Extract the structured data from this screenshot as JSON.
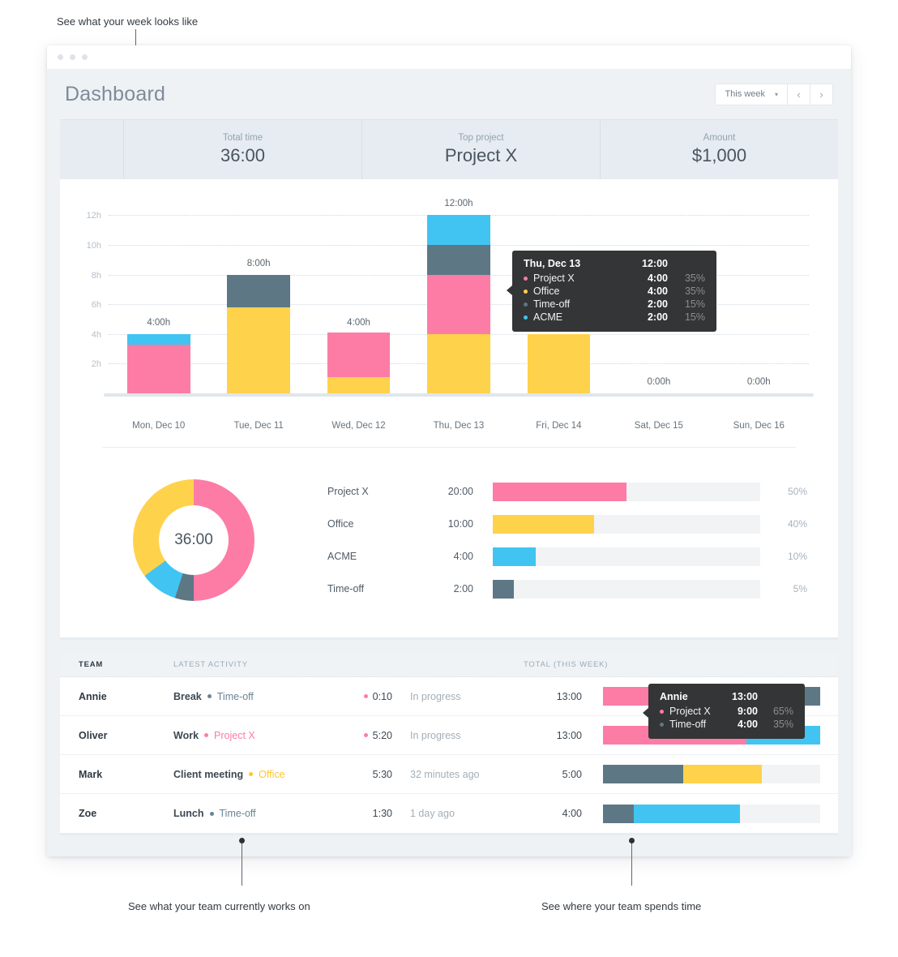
{
  "colors": {
    "project_x": "#fd7ca6",
    "office": "#ffd24c",
    "acme": "#41c4f2",
    "time_off": "#5d7785",
    "track": "#f1f3f4",
    "tooltip_bg": "#333536"
  },
  "annotations": {
    "top": "See what your week looks like",
    "bottom_left": "See what your team currently works on",
    "bottom_right": "See where your team spends time"
  },
  "header": {
    "title": "Dashboard",
    "range_selector": "This week",
    "prev_label": "‹",
    "next_label": "›",
    "caret": "▾"
  },
  "kpis": [
    {
      "label": "Total time",
      "value": "36:00"
    },
    {
      "label": "Top project",
      "value": "Project X"
    },
    {
      "label": "Amount",
      "value": "$1,000"
    }
  ],
  "chart_data": {
    "type": "bar",
    "title": "",
    "xlabel": "",
    "ylabel": "",
    "ylim": [
      0,
      13
    ],
    "grid": true,
    "yticks": [
      "2h",
      "4h",
      "6h",
      "8h",
      "10h",
      "12h"
    ],
    "ytick_values": [
      2,
      4,
      6,
      8,
      10,
      12
    ],
    "categories": [
      "Mon, Dec 10",
      "Tue, Dec 11",
      "Wed, Dec 12",
      "Thu, Dec 13",
      "Fri, Dec 14",
      "Sat, Dec 15",
      "Sun, Dec 16"
    ],
    "totals_label": [
      "4:00h",
      "8:00h",
      "4:00h",
      "12:00h",
      "",
      "0:00h",
      "0:00h"
    ],
    "totals": [
      4,
      8,
      4,
      12,
      4,
      0,
      0
    ],
    "series": [
      {
        "name": "Project X",
        "color": "#fd7ca6",
        "values": [
          3.3,
          0,
          3.0,
          4,
          0,
          0,
          0
        ]
      },
      {
        "name": "Office",
        "color": "#ffd24c",
        "values": [
          0,
          5.8,
          1.1,
          4,
          4,
          0,
          0
        ]
      },
      {
        "name": "Time-off",
        "color": "#5d7785",
        "values": [
          0,
          2.2,
          0,
          2,
          0,
          0,
          0
        ]
      },
      {
        "name": "ACME",
        "color": "#41c4f2",
        "values": [
          0.7,
          0,
          0,
          2,
          0,
          0,
          0
        ]
      }
    ],
    "legend_position": "none"
  },
  "bar_tooltip": {
    "title": "Thu, Dec 13",
    "total": "12:00",
    "rows": [
      {
        "name": "Project X",
        "value": "4:00",
        "pct": "35%",
        "color": "#fd7ca6"
      },
      {
        "name": "Office",
        "value": "4:00",
        "pct": "35%",
        "color": "#ffd24c"
      },
      {
        "name": "Time-off",
        "value": "2:00",
        "pct": "15%",
        "color": "#5d7785"
      },
      {
        "name": "ACME",
        "value": "2:00",
        "pct": "15%",
        "color": "#41c4f2"
      }
    ]
  },
  "donut": {
    "center_label": "36:00",
    "type": "pie",
    "slices": [
      {
        "name": "Project X",
        "pct": 50,
        "color": "#fd7ca6"
      },
      {
        "name": "Time-off",
        "pct": 5,
        "color": "#5d7785"
      },
      {
        "name": "ACME",
        "pct": 10,
        "color": "#41c4f2"
      },
      {
        "name": "Office",
        "pct": 35,
        "color": "#ffd24c"
      }
    ]
  },
  "breakdown": {
    "type": "bar",
    "rows": [
      {
        "name": "Project X",
        "time": "20:00",
        "pct": "50%",
        "fill": 50,
        "color": "#fd7ca6"
      },
      {
        "name": "Office",
        "time": "10:00",
        "pct": "40%",
        "fill": 38,
        "color": "#ffd24c"
      },
      {
        "name": "ACME",
        "time": "4:00",
        "pct": "10%",
        "fill": 16,
        "color": "#41c4f2"
      },
      {
        "name": "Time-off",
        "time": "2:00",
        "pct": "5%",
        "fill": 8,
        "color": "#5d7785"
      }
    ]
  },
  "team_table": {
    "columns": [
      "TEAM",
      "LATEST ACTIVITY",
      "TOTAL (THIS WEEK)"
    ],
    "rows": [
      {
        "name": "Annie",
        "activity": "Break",
        "tag": "Time-off",
        "tag_color": "#6a8494",
        "duration": "0:10",
        "duration_bullet": "#fd7ca6",
        "status": "In progress",
        "total": "13:00",
        "segments": [
          {
            "name": "Project X",
            "pct": 65,
            "color": "#fd7ca6"
          },
          {
            "name": "Time-off",
            "pct": 35,
            "color": "#5d7785"
          }
        ]
      },
      {
        "name": "Oliver",
        "activity": "Work",
        "tag": "Project X",
        "tag_color": "#fd7ca6",
        "duration": "5:20",
        "duration_bullet": "#fd7ca6",
        "status": "In progress",
        "total": "13:00",
        "segments": [
          {
            "name": "Project X",
            "pct": 66,
            "color": "#fd7ca6"
          },
          {
            "name": "ACME",
            "pct": 34,
            "color": "#41c4f2"
          }
        ]
      },
      {
        "name": "Mark",
        "activity": "Client meeting",
        "tag": "Office",
        "tag_color": "#ffc72c",
        "duration": "5:30",
        "duration_bullet": "",
        "status": "32 minutes ago",
        "total": "5:00",
        "segments": [
          {
            "name": "Time-off",
            "pct": 37,
            "color": "#5d7785"
          },
          {
            "name": "Office",
            "pct": 36,
            "color": "#ffd24c"
          }
        ]
      },
      {
        "name": "Zoe",
        "activity": "Lunch",
        "tag": "Time-off",
        "tag_color": "#6a8494",
        "duration": "1:30",
        "duration_bullet": "",
        "status": "1 day ago",
        "total": "4:00",
        "segments": [
          {
            "name": "Time-off",
            "pct": 14,
            "color": "#5d7785"
          },
          {
            "name": "ACME",
            "pct": 49,
            "color": "#41c4f2"
          }
        ]
      }
    ]
  },
  "team_tooltip": {
    "title": "Annie",
    "total": "13:00",
    "rows": [
      {
        "name": "Project X",
        "value": "9:00",
        "pct": "65%",
        "color": "#fd7ca6"
      },
      {
        "name": "Time-off",
        "value": "4:00",
        "pct": "35%",
        "color": "#5d7785"
      }
    ]
  }
}
